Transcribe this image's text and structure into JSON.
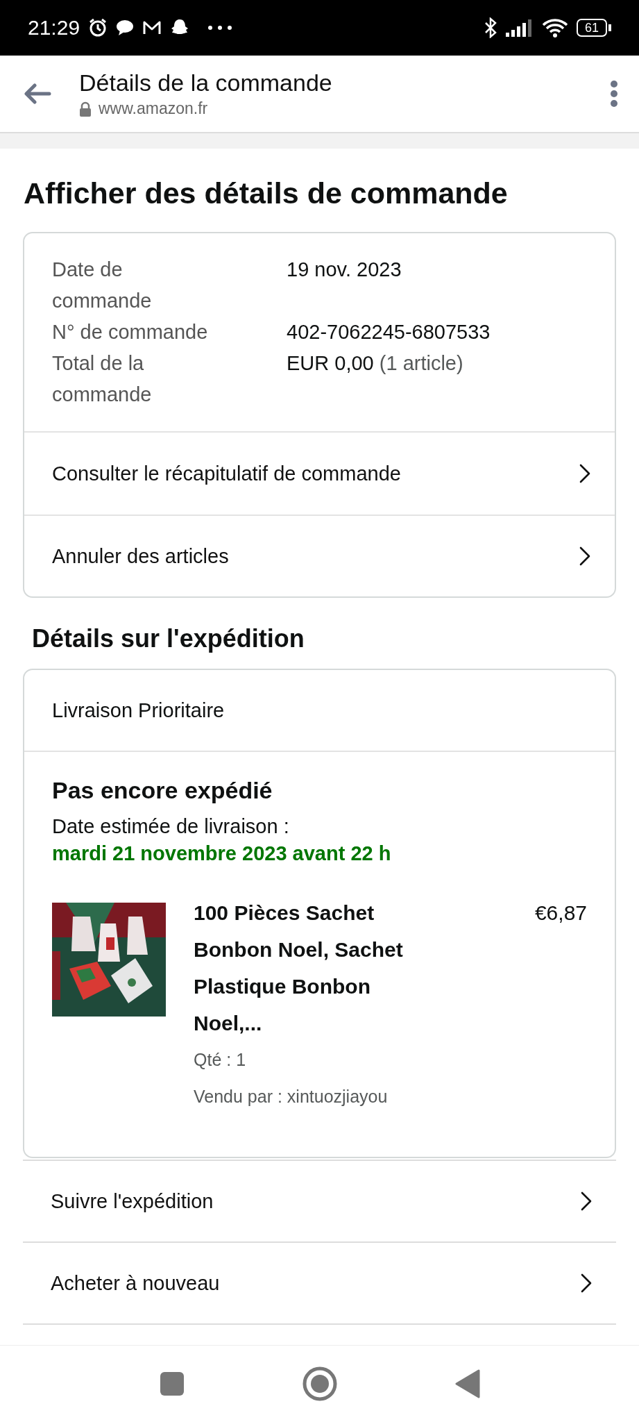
{
  "status_bar": {
    "time": "21:29",
    "battery": "61"
  },
  "browser_bar": {
    "title": "Détails de la commande",
    "url": "www.amazon.fr"
  },
  "heading": "Afficher des détails de commande",
  "order_summary": {
    "fields": [
      {
        "label": "Date de commande",
        "value": "19 nov. 2023"
      },
      {
        "label": "N° de commande",
        "value": "402-7062245-6807533"
      },
      {
        "label": "Total de la commande",
        "value": "EUR 0,00",
        "note": "(1 article)"
      }
    ],
    "links": [
      "Consulter le récapitulatif de commande",
      "Annuler des articles"
    ]
  },
  "shipment_heading": "Détails sur l'expédition",
  "shipment": {
    "method": "Livraison Prioritaire",
    "status": "Pas encore expédié",
    "delivery_label": "Date estimée de livraison :",
    "delivery_date": "mardi 21 novembre 2023 avant 22 h",
    "items": [
      {
        "title": "100 Pièces Sachet Bonbon Noel, Sachet Plastique Bonbon Noel,...",
        "price": "€6,87",
        "quantity": "Qté : 1",
        "seller": "Vendu par : xintuozjiayou",
        "kind": "picture"
      }
    ]
  },
  "actions": [
    "Suivre l'expédition",
    "Acheter à nouveau"
  ]
}
